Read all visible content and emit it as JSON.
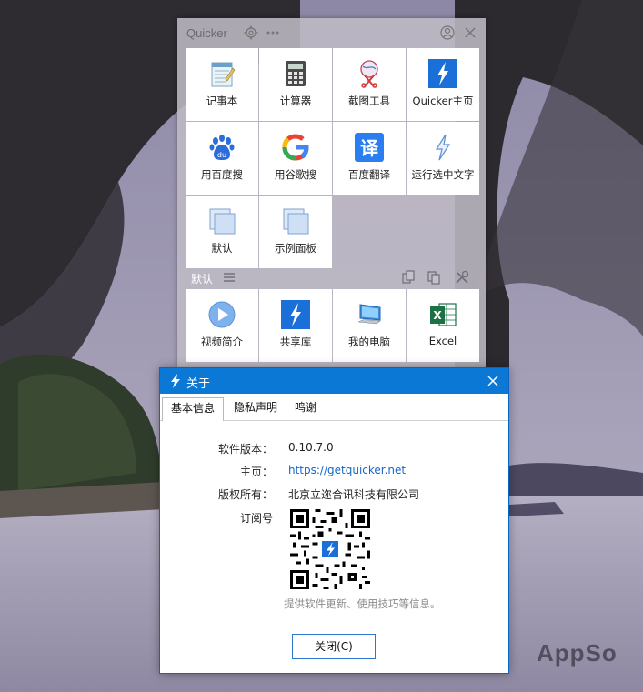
{
  "quicker": {
    "app_name": "Quicker",
    "tiles_top": [
      {
        "label": "记事本",
        "icon": "notepad-icon"
      },
      {
        "label": "计算器",
        "icon": "calculator-icon"
      },
      {
        "label": "截图工具",
        "icon": "snipping-tool-icon"
      },
      {
        "label": "Quicker主页",
        "icon": "quicker-lightning-icon"
      },
      {
        "label": "用百度搜",
        "icon": "baidu-paw-icon"
      },
      {
        "label": "用谷歌搜",
        "icon": "google-g-icon"
      },
      {
        "label": "百度翻译",
        "icon": "translate-icon"
      },
      {
        "label": "运行选中文字",
        "icon": "lightning-outline-icon"
      },
      {
        "label": "默认",
        "icon": "panel-squares-icon"
      },
      {
        "label": "示例面板",
        "icon": "panel-squares-icon"
      }
    ],
    "section_label": "默认",
    "tiles_bottom": [
      {
        "label": "视频简介",
        "icon": "play-circle-icon"
      },
      {
        "label": "共享库",
        "icon": "quicker-lightning-icon"
      },
      {
        "label": "我的电脑",
        "icon": "computer-icon"
      },
      {
        "label": "Excel",
        "icon": "excel-icon"
      }
    ]
  },
  "dialog": {
    "title": "关于",
    "tabs": [
      "基本信息",
      "隐私声明",
      "鸣谢"
    ],
    "version_label": "软件版本：",
    "version_value": "0.10.7.0",
    "homepage_label": "主页：",
    "homepage_value": "https://getquicker.net",
    "copyright_label": "版权所有：",
    "copyright_value": "北京立迩合讯科技有限公司",
    "subscribe_label": "订阅号",
    "hint": "提供软件更新、使用技巧等信息。",
    "close_button": "关闭(C)"
  },
  "watermark": "AppSo",
  "colors": {
    "dialog_title_bar": "#0c78d6",
    "link": "#1766c8",
    "quicker_blue": "#1a6fd8"
  }
}
